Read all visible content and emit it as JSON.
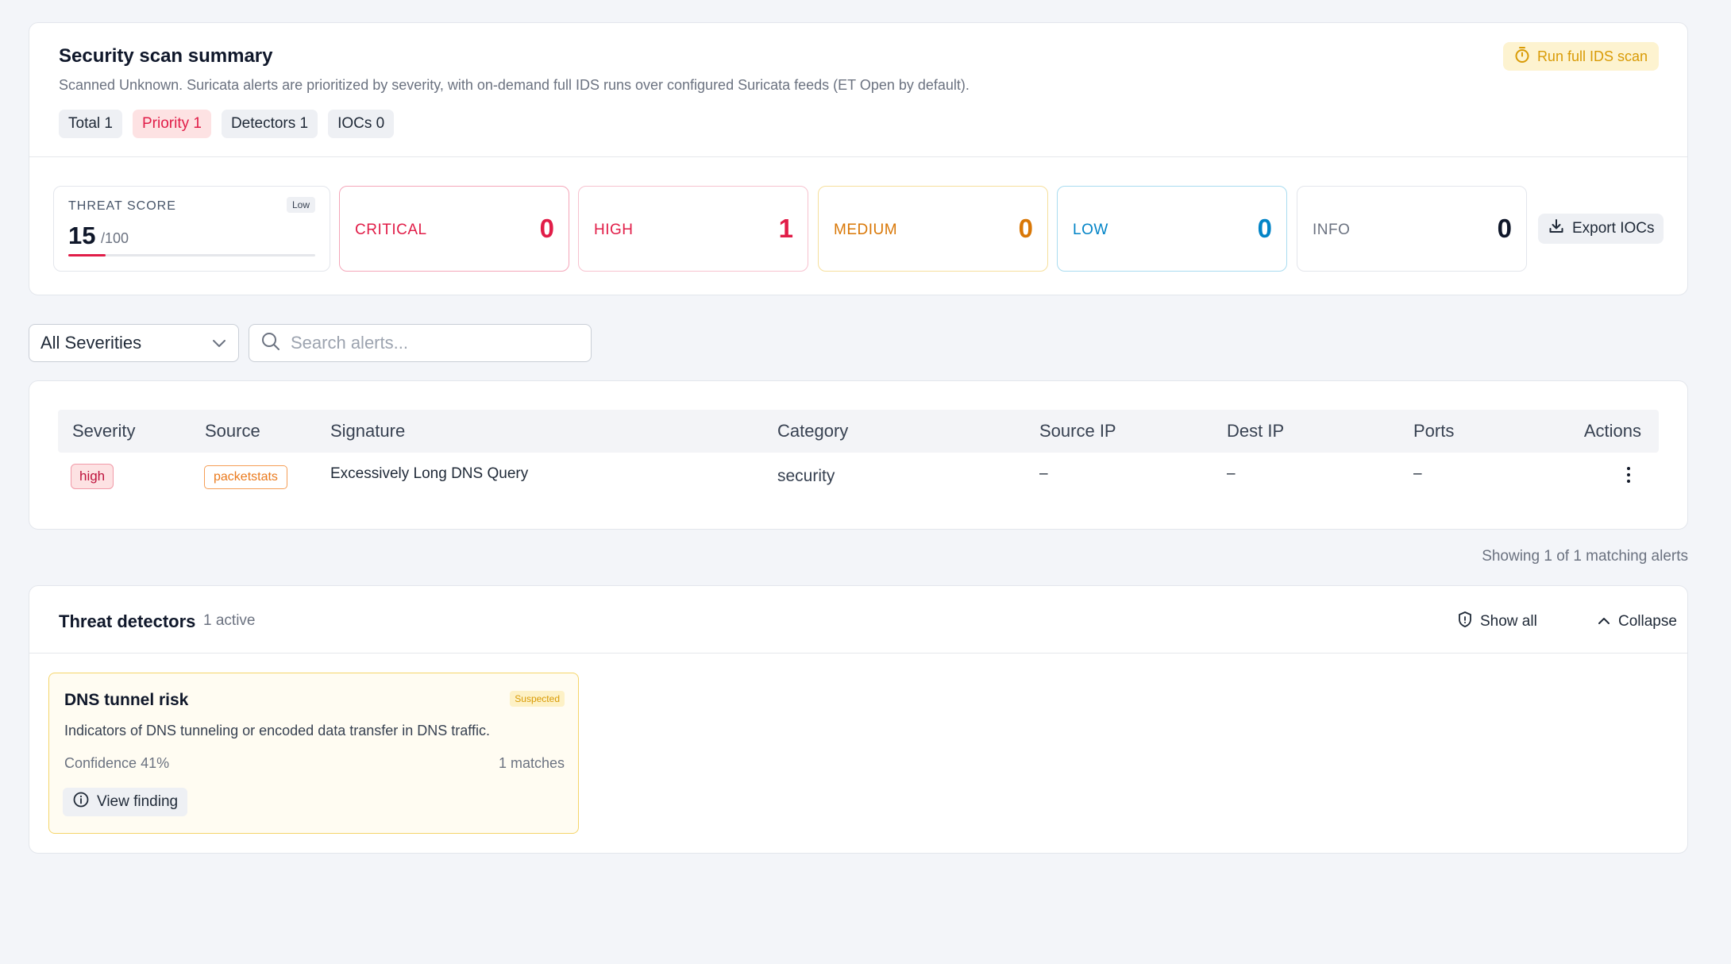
{
  "summary": {
    "title": "Security scan summary",
    "description": "Scanned Unknown. Suricata alerts are prioritized by severity, with on-demand full IDS runs over configured Suricata feeds (ET Open by default).",
    "run_button": "Run full IDS scan",
    "chips": {
      "total": "Total 1",
      "priority": "Priority 1",
      "detectors": "Detectors 1",
      "iocs": "IOCs 0"
    }
  },
  "threat": {
    "label": "THREAT SCORE",
    "badge": "Low",
    "score": "15",
    "max": "/100",
    "score_fraction": 0.15
  },
  "severity_counts": {
    "critical": {
      "label": "CRITICAL",
      "value": "0"
    },
    "high": {
      "label": "HIGH",
      "value": "1"
    },
    "medium": {
      "label": "MEDIUM",
      "value": "0"
    },
    "low": {
      "label": "LOW",
      "value": "0"
    },
    "info": {
      "label": "INFO",
      "value": "0"
    }
  },
  "export_button": "Export IOCs",
  "filters": {
    "severity_selected": "All Severities",
    "search_placeholder": "Search alerts..."
  },
  "table": {
    "headers": {
      "severity": "Severity",
      "source": "Source",
      "signature": "Signature",
      "category": "Category",
      "source_ip": "Source IP",
      "dest_ip": "Dest IP",
      "ports": "Ports",
      "actions": "Actions"
    },
    "rows": [
      {
        "severity": "high",
        "source": "packetstats",
        "signature": "Excessively Long DNS Query",
        "category": "security",
        "source_ip": "–",
        "dest_ip": "–",
        "ports": "–"
      }
    ]
  },
  "showing_text": "Showing 1 of 1 matching alerts",
  "detectors": {
    "title": "Threat detectors",
    "active": "1 active",
    "show_all": "Show all",
    "collapse": "Collapse",
    "cards": [
      {
        "title": "DNS tunnel risk",
        "badge": "Suspected",
        "description": "Indicators of DNS tunneling or encoded data transfer in DNS traffic.",
        "confidence": "Confidence 41%",
        "matches": "1 matches",
        "view_button": "View finding"
      }
    ]
  },
  "colors": {
    "critical": "#e11d48",
    "medium": "#d97706",
    "low": "#0284c7",
    "warning": "#d99b06"
  }
}
